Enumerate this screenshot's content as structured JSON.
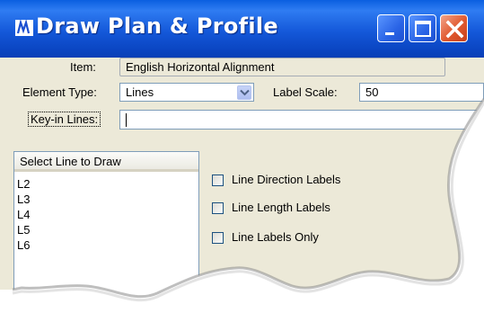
{
  "window": {
    "title": "Draw Plan & Profile"
  },
  "title_buttons": [
    "minimize-icon",
    "maximize-icon",
    "close-icon"
  ],
  "form": {
    "item_label": "Item:",
    "item_value": "English Horizontal Alignment",
    "element_type_label": "Element Type:",
    "element_type_value": "Lines",
    "label_scale_label": "Label Scale:",
    "label_scale_value": "50",
    "keyin_label": "Key-in Lines:",
    "keyin_value": ""
  },
  "list": {
    "header": "Select Line to Draw",
    "items": [
      "L2",
      "L3",
      "L4",
      "L5",
      "L6"
    ]
  },
  "options": [
    {
      "label": "Line Direction Labels",
      "checked": false
    },
    {
      "label": "Line Length Labels",
      "checked": false
    },
    {
      "label": "Line Labels Only",
      "checked": false
    }
  ],
  "colors": {
    "title_bar": "#1458d9",
    "dialog_bg": "#ece9d8",
    "close_button": "#e0582e"
  }
}
